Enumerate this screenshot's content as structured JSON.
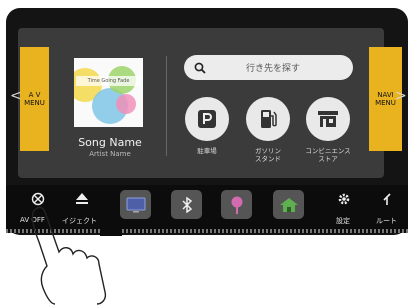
{
  "left_tab": {
    "line1": "A V",
    "line2": "MENU"
  },
  "right_tab": {
    "line1": "NAVI",
    "line2": "MENU"
  },
  "nav_arrows": {
    "left": "<",
    "right": ">"
  },
  "now_playing": {
    "album_text": "Time Going Fade",
    "song_name": "Song Name",
    "artist_name": "Artist Name"
  },
  "search": {
    "placeholder": "行き先を探す"
  },
  "poi_buttons": [
    {
      "icon": "parking-icon",
      "label1": "駐車場",
      "label2": ""
    },
    {
      "icon": "gas-station-icon",
      "label1": "ガソリン",
      "label2": "スタンド"
    },
    {
      "icon": "convenience-store-icon",
      "label1": "コンビニエンス",
      "label2": "ストア"
    }
  ],
  "bottom_bar": {
    "av_off": "AV OFF",
    "eject": "イジェクト",
    "settings": "設定",
    "route": "ルート",
    "apps": [
      "tv-icon",
      "bluetooth-icon",
      "map-pin-icon",
      "home-icon"
    ]
  },
  "colors": {
    "accent": "#e9b320",
    "panel": "#3b3b3b",
    "background": "#141414"
  }
}
